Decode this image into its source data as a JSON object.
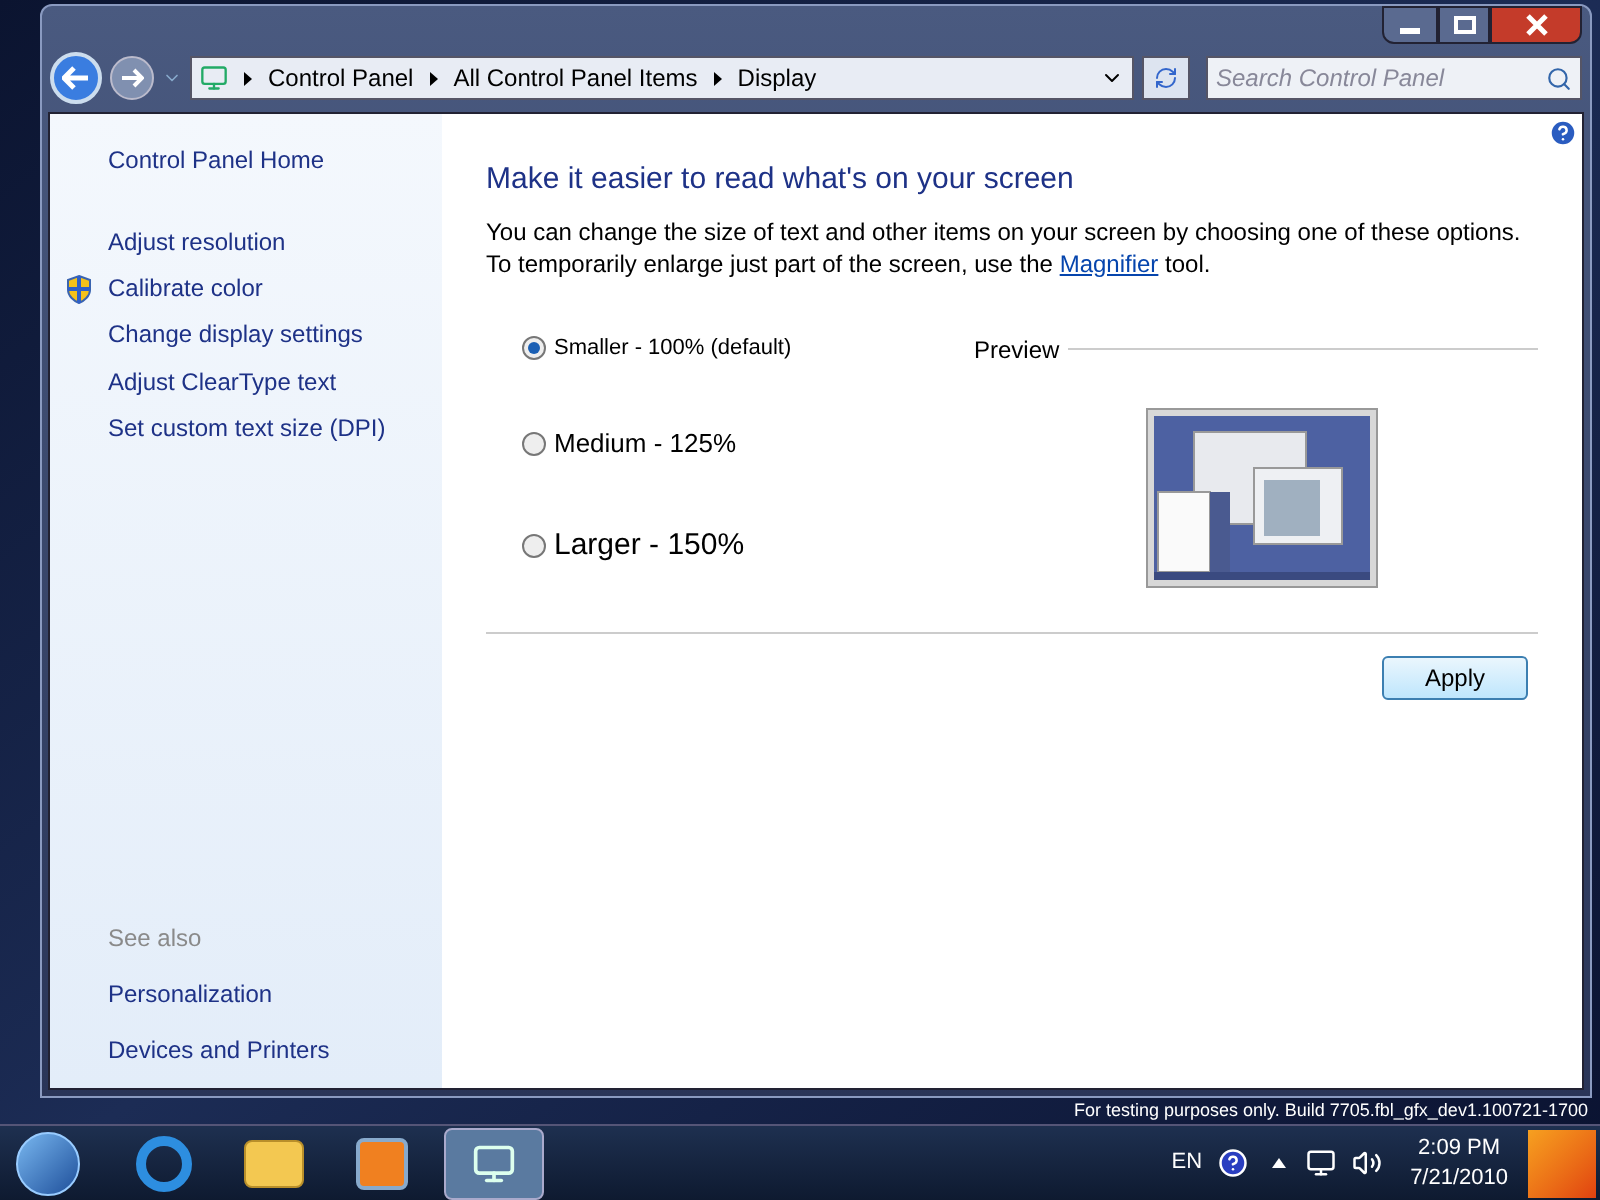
{
  "window": {
    "breadcrumb": [
      "Control Panel",
      "All Control Panel Items",
      "Display"
    ],
    "search": {
      "placeholder": "Search Control Panel"
    }
  },
  "sidebar": {
    "home": "Control Panel Home",
    "items": [
      {
        "label": "Adjust resolution",
        "shield": false
      },
      {
        "label": "Calibrate color",
        "shield": true
      },
      {
        "label": "Change display settings",
        "shield": false
      },
      {
        "label": "Adjust ClearType text",
        "shield": false
      },
      {
        "label": "Set custom text size (DPI)",
        "shield": false
      }
    ],
    "see_also": {
      "heading": "See also",
      "links": [
        "Personalization",
        "Devices and Printers"
      ]
    }
  },
  "content": {
    "title": "Make it easier to read what's on your screen",
    "description_before": "You can change the size of text and other items on your screen by choosing one of these options. To temporarily enlarge just part of the screen, use the",
    "link": "Magnifier",
    "description_after": "tool.",
    "options": [
      {
        "label": "Smaller - 100% (default)",
        "kind": "small",
        "selected": true
      },
      {
        "label": "Medium - 125%",
        "kind": "medium",
        "selected": false
      },
      {
        "label": "Larger - 150%",
        "kind": "large",
        "selected": false
      }
    ],
    "preview_label": "Preview",
    "apply_button": "Apply"
  },
  "desktop": {
    "build_text": "For testing purposes only. Build 7705.fbl_gfx_dev1.100721-1700"
  },
  "taskbar": {
    "language": "EN",
    "time": "2:09 PM",
    "date": "7/21/2010"
  }
}
